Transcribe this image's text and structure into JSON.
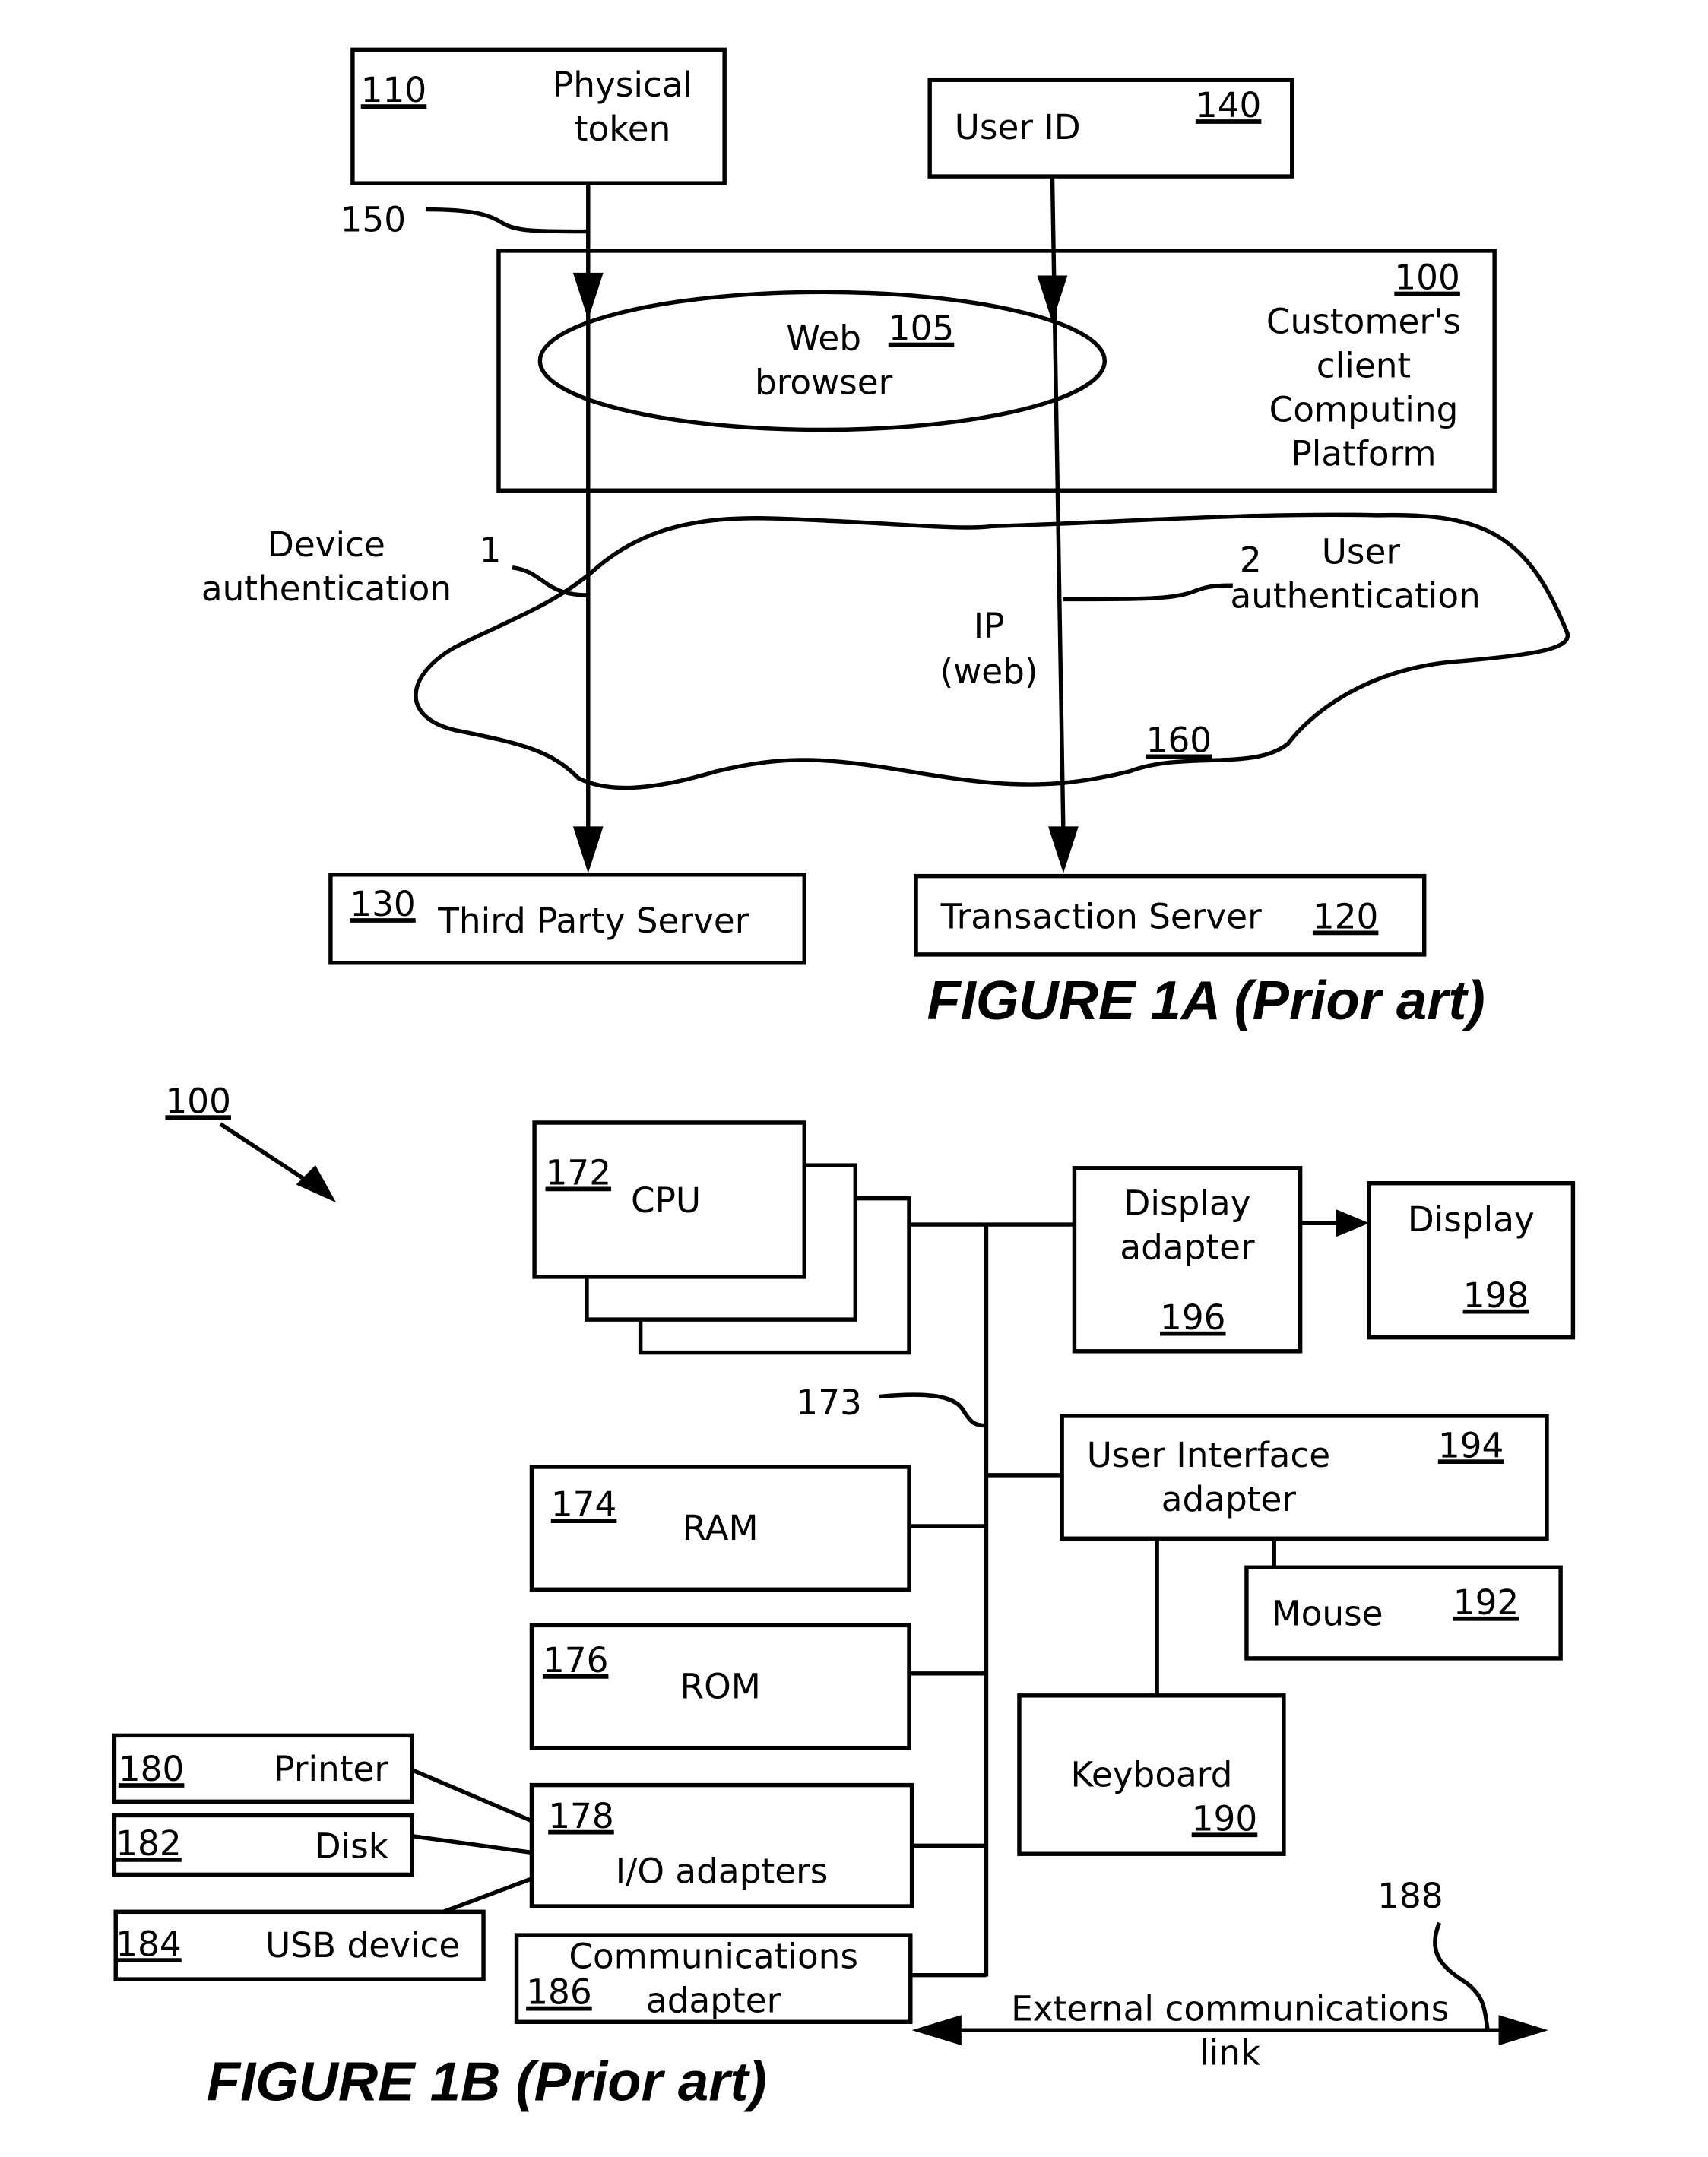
{
  "figure_1a": {
    "caption": "FIGURE 1A (Prior art)",
    "physical_token": {
      "ref": "110",
      "line1": "Physical",
      "line2": "token"
    },
    "user_id": {
      "ref": "140",
      "label": "User ID"
    },
    "connector_ref": "150",
    "platform": {
      "ref": "100",
      "line1": "Customer's",
      "line2": "client",
      "line3": "Computing",
      "line4": "Platform"
    },
    "browser": {
      "ref": "105",
      "line1": "Web",
      "line2": "browser"
    },
    "device_auth": {
      "num": "1",
      "line1": "Device",
      "line2": "authentication"
    },
    "user_auth": {
      "num": "2",
      "line1": "User",
      "line2": "authentication"
    },
    "network": {
      "ref": "160",
      "line1": "IP",
      "line2": "(web)"
    },
    "third_party": {
      "ref": "130",
      "label": "Third Party Server"
    },
    "transaction": {
      "ref": "120",
      "label": "Transaction Server"
    }
  },
  "figure_1b": {
    "caption": "FIGURE 1B (Prior art)",
    "system_ref": "100",
    "bus_ref": "173",
    "cpu": {
      "ref": "172",
      "label": "CPU"
    },
    "display_adapter": {
      "ref": "196",
      "line1": "Display",
      "line2": "adapter"
    },
    "display": {
      "ref": "198",
      "label": "Display"
    },
    "ui_adapter": {
      "ref": "194",
      "line1": "User  Interface",
      "line2": "adapter"
    },
    "mouse": {
      "ref": "192",
      "label": "Mouse"
    },
    "keyboard": {
      "ref": "190",
      "label": "Keyboard"
    },
    "ram": {
      "ref": "174",
      "label": "RAM"
    },
    "rom": {
      "ref": "176",
      "label": "ROM"
    },
    "io": {
      "ref": "178",
      "label": "I/O adapters"
    },
    "printer": {
      "ref": "180",
      "label": "Printer"
    },
    "disk": {
      "ref": "182",
      "label": "Disk"
    },
    "usb": {
      "ref": "184",
      "label": "USB device"
    },
    "comm": {
      "ref": "186",
      "line1": "Communications",
      "line2": "adapter"
    },
    "ext_link": {
      "ref": "188",
      "line1": "External communications",
      "line2": "link"
    }
  }
}
